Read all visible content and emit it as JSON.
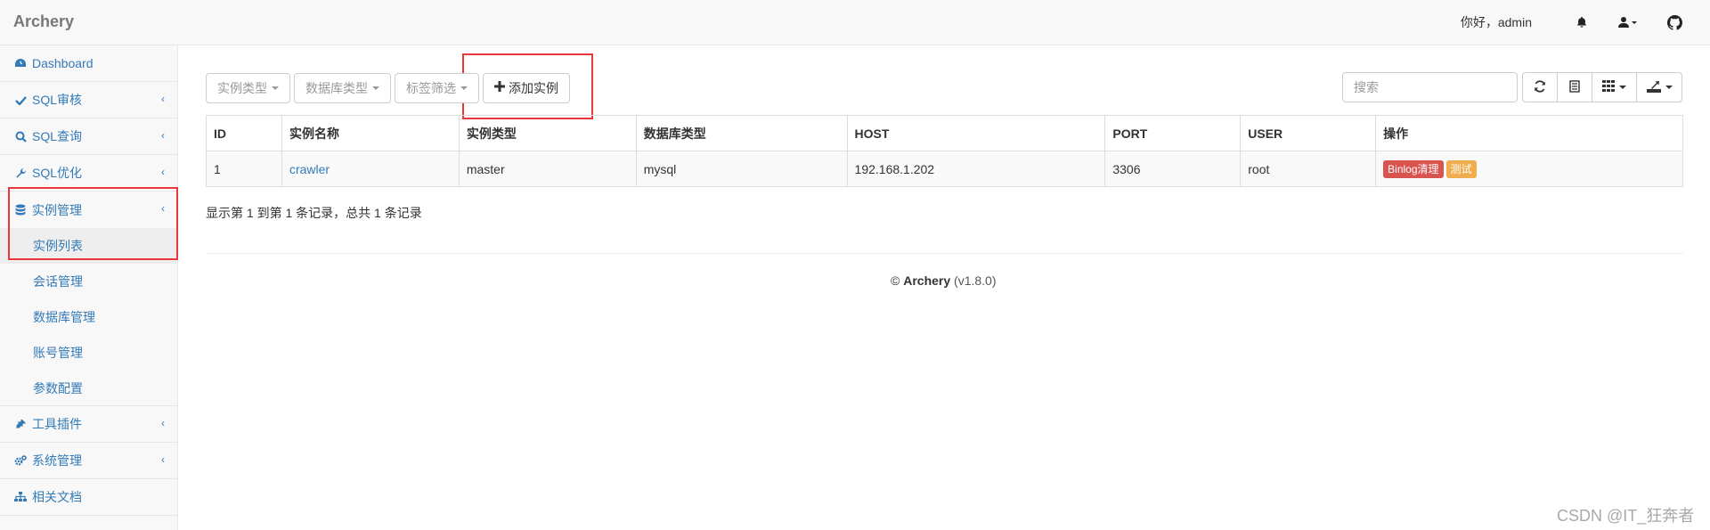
{
  "app": {
    "brand": "Archery"
  },
  "navbar": {
    "greeting": "你好，admin",
    "icons": [
      "bell-icon",
      "user-icon",
      "github-icon"
    ]
  },
  "sidebar": {
    "items": [
      {
        "label": "Dashboard",
        "icon": "dashboard-icon"
      },
      {
        "label": "SQL审核",
        "icon": "check-icon",
        "chevron": "‹"
      },
      {
        "label": "SQL查询",
        "icon": "search-icon",
        "chevron": "‹"
      },
      {
        "label": "SQL优化",
        "icon": "wrench-icon",
        "chevron": "‹"
      },
      {
        "label": "实例管理",
        "icon": "database-icon",
        "chevron": "‹"
      },
      {
        "label": "工具插件",
        "icon": "plug-icon",
        "chevron": "‹"
      },
      {
        "label": "系统管理",
        "icon": "gears-icon",
        "chevron": "‹"
      },
      {
        "label": "相关文档",
        "icon": "sitemap-icon"
      }
    ],
    "sub_items": [
      "实例列表",
      "会话管理",
      "数据库管理",
      "账号管理",
      "参数配置"
    ]
  },
  "toolbar": {
    "filter_instance_type": "实例类型",
    "filter_db_type": "数据库类型",
    "filter_tag": "标签筛选",
    "add_label": "添加实例",
    "search_placeholder": "搜索"
  },
  "table": {
    "columns": [
      "ID",
      "实例名称",
      "实例类型",
      "数据库类型",
      "HOST",
      "PORT",
      "USER",
      "操作"
    ],
    "rows": [
      {
        "id": "1",
        "name": "crawler",
        "type": "master",
        "db_type": "mysql",
        "host": "192.168.1.202",
        "port": "3306",
        "user": "root",
        "actions": [
          "Binlog清理",
          "测试"
        ]
      }
    ]
  },
  "pagination": {
    "info": "显示第 1 到第 1 条记录，总共 1 条记录"
  },
  "footer": {
    "copyright": "©",
    "name": "Archery",
    "version": "(v1.8.0)"
  },
  "watermark": "CSDN @IT_狂奔者",
  "colors": {
    "accent": "#337ab7",
    "danger": "#d9534f",
    "warning": "#f0ad4e",
    "highlight_box": "#e8383d"
  }
}
